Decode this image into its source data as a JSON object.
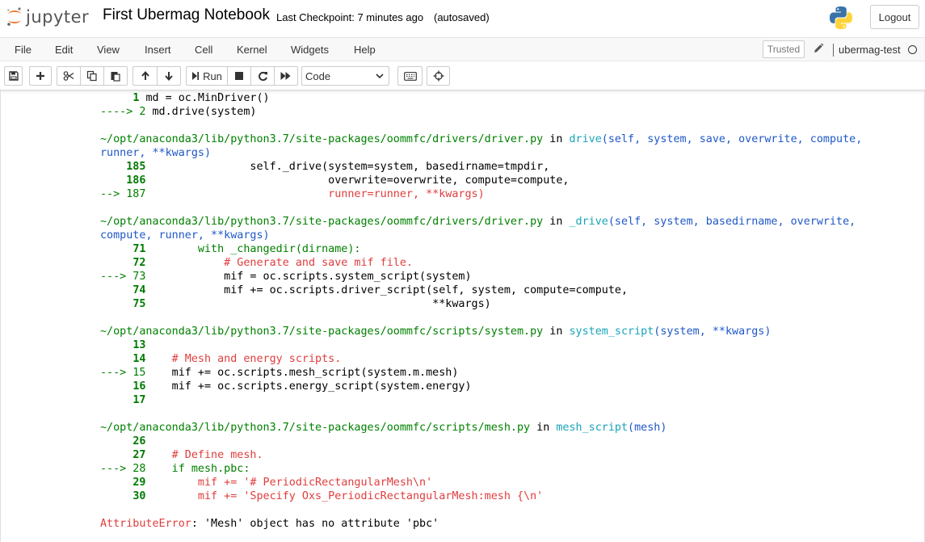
{
  "header": {
    "logo_text": "jupyter",
    "notebook_title": "First Ubermag Notebook",
    "checkpoint": "Last Checkpoint: 7 minutes ago",
    "autosave": "(autosaved)",
    "logout_label": "Logout"
  },
  "menubar": {
    "items": [
      "File",
      "Edit",
      "View",
      "Insert",
      "Cell",
      "Kernel",
      "Widgets",
      "Help"
    ],
    "trusted_label": "Trusted",
    "kernel_name": "ubermag-test"
  },
  "toolbar": {
    "run_label": "Run",
    "cell_type": "Code"
  },
  "traceback": {
    "frame0": {
      "line1_num": "1",
      "line1_code": "md = oc.MinDriver()",
      "arrow": "---->",
      "line2_num": "2",
      "line2_code": "md.drive(system)"
    },
    "frame1": {
      "path": "~/opt/anaconda3/lib/python3.7/site-packages/oommfc/drivers/driver.py",
      "in": "in",
      "func": "drive",
      "sig1": "(self, system, save, overwrite, compute,",
      "sig2": "runner, **kwargs)",
      "lines": [
        {
          "num": "185",
          "code": "                self._drive(system=system, basedirname=tmpdir,"
        },
        {
          "num": "186",
          "code": "                            overwrite=overwrite, compute=compute,"
        },
        {
          "num": "--> 187",
          "code": "                            runner=runner, **kwargs)"
        }
      ]
    },
    "frame2": {
      "path": "~/opt/anaconda3/lib/python3.7/site-packages/oommfc/drivers/driver.py",
      "in": "in",
      "func": "_drive",
      "sig1": "(self, system, basedirname, overwrite,",
      "sig2": "compute, runner, **kwargs)",
      "lines": [
        {
          "num": "71",
          "code": "        with _changedir(dirname):"
        },
        {
          "num": "72",
          "code": "            # Generate and save mif file."
        },
        {
          "num": "---> 73",
          "code": "            mif = oc.scripts.system_script(system)"
        },
        {
          "num": "74",
          "code": "            mif += oc.scripts.driver_script(self, system, compute=compute,"
        },
        {
          "num": "75",
          "code": "                                            **kwargs)"
        }
      ]
    },
    "frame3": {
      "path": "~/opt/anaconda3/lib/python3.7/site-packages/oommfc/scripts/system.py",
      "in": "in",
      "func": "system_script",
      "sig1": "(system, **kwargs)",
      "lines": [
        {
          "num": "13",
          "code": ""
        },
        {
          "num": "14",
          "code": "    # Mesh and energy scripts."
        },
        {
          "num": "---> 15",
          "code": "    mif += oc.scripts.mesh_script(system.m.mesh)"
        },
        {
          "num": "16",
          "code": "    mif += oc.scripts.energy_script(system.energy)"
        },
        {
          "num": "17",
          "code": ""
        }
      ]
    },
    "frame4": {
      "path": "~/opt/anaconda3/lib/python3.7/site-packages/oommfc/scripts/mesh.py",
      "in": "in",
      "func": "mesh_script",
      "sig1": "(mesh)",
      "lines": [
        {
          "num": "26",
          "code": ""
        },
        {
          "num": "27",
          "code": "    # Define mesh."
        },
        {
          "num": "---> 28",
          "code": "    if mesh.pbc:"
        },
        {
          "num": "29",
          "code": "        mif += '# PeriodicRectangularMesh\\n'"
        },
        {
          "num": "30",
          "code": "        mif += 'Specify Oxs_PeriodicRectangularMesh:mesh {\\n'"
        }
      ]
    },
    "error": {
      "type": "AttributeError",
      "message": ": 'Mesh' object has no attribute 'pbc'"
    }
  }
}
